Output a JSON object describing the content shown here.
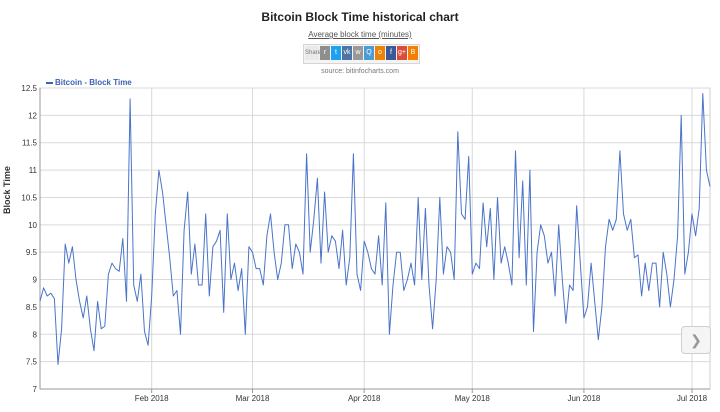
{
  "header": {
    "title": "Bitcoin Block Time historical chart",
    "subtitle": "Average block time (minutes)",
    "source": "source: bitinfocharts.com",
    "share": {
      "label": "Share",
      "buttons": [
        {
          "name": "reddit",
          "glyph": "r",
          "color": "#8e8e8e"
        },
        {
          "name": "twitter",
          "glyph": "t",
          "color": "#1da1f2"
        },
        {
          "name": "vk",
          "glyph": "vk",
          "color": "#4c75a3"
        },
        {
          "name": "weibo",
          "glyph": "w",
          "color": "#999999"
        },
        {
          "name": "qq",
          "glyph": "Q",
          "color": "#4c9bd5"
        },
        {
          "name": "odnoklassniki",
          "glyph": "o",
          "color": "#ee8208"
        },
        {
          "name": "facebook",
          "glyph": "f",
          "color": "#3b5998"
        },
        {
          "name": "google-plus",
          "glyph": "g+",
          "color": "#dd4b39"
        },
        {
          "name": "blogger",
          "glyph": "B",
          "color": "#f57d00"
        }
      ]
    }
  },
  "nav": {
    "glyph": "❯"
  },
  "chart_data": {
    "type": "line",
    "title": "Bitcoin Block Time historical chart",
    "subtitle": "Average block time (minutes)",
    "xlabel": "",
    "ylabel": "Block Time",
    "ylim": [
      7,
      12.5
    ],
    "yticks": [
      7,
      7.5,
      8,
      8.5,
      9,
      9.5,
      10,
      10.5,
      11,
      11.5,
      12,
      12.5
    ],
    "xlim": [
      "2018-01-01",
      "2018-07-06"
    ],
    "xticks": [
      {
        "date": "2018-02-01",
        "label": "Feb 2018"
      },
      {
        "date": "2018-03-01",
        "label": "Mar 2018"
      },
      {
        "date": "2018-04-01",
        "label": "Apr 2018"
      },
      {
        "date": "2018-05-01",
        "label": "May 2018"
      },
      {
        "date": "2018-06-01",
        "label": "Jun 2018"
      },
      {
        "date": "2018-07-01",
        "label": "Jul 2018"
      }
    ],
    "grid": true,
    "legend_position": "top-left",
    "series": [
      {
        "name": "Bitcoin - Block Time",
        "color": "#4a74c9",
        "points": [
          [
            "2018-01-01",
            8.6
          ],
          [
            "2018-01-02",
            8.85
          ],
          [
            "2018-01-03",
            8.7
          ],
          [
            "2018-01-04",
            8.75
          ],
          [
            "2018-01-05",
            8.65
          ],
          [
            "2018-01-06",
            7.45
          ],
          [
            "2018-01-07",
            8.1
          ],
          [
            "2018-01-08",
            9.65
          ],
          [
            "2018-01-09",
            9.3
          ],
          [
            "2018-01-10",
            9.6
          ],
          [
            "2018-01-11",
            9.0
          ],
          [
            "2018-01-12",
            8.6
          ],
          [
            "2018-01-13",
            8.3
          ],
          [
            "2018-01-14",
            8.7
          ],
          [
            "2018-01-15",
            8.1
          ],
          [
            "2018-01-16",
            7.7
          ],
          [
            "2018-01-17",
            8.6
          ],
          [
            "2018-01-18",
            8.1
          ],
          [
            "2018-01-19",
            8.15
          ],
          [
            "2018-01-20",
            9.1
          ],
          [
            "2018-01-21",
            9.3
          ],
          [
            "2018-01-22",
            9.2
          ],
          [
            "2018-01-23",
            9.15
          ],
          [
            "2018-01-24",
            9.75
          ],
          [
            "2018-01-25",
            8.6
          ],
          [
            "2018-01-26",
            12.3
          ],
          [
            "2018-01-27",
            8.9
          ],
          [
            "2018-01-28",
            8.6
          ],
          [
            "2018-01-29",
            9.1
          ],
          [
            "2018-01-30",
            8.05
          ],
          [
            "2018-01-31",
            7.8
          ],
          [
            "2018-02-01",
            8.7
          ],
          [
            "2018-02-02",
            10.2
          ],
          [
            "2018-02-03",
            11.0
          ],
          [
            "2018-02-04",
            10.6
          ],
          [
            "2018-02-05",
            10.0
          ],
          [
            "2018-02-06",
            9.4
          ],
          [
            "2018-02-07",
            8.7
          ],
          [
            "2018-02-08",
            8.8
          ],
          [
            "2018-02-09",
            8.0
          ],
          [
            "2018-02-10",
            9.9
          ],
          [
            "2018-02-11",
            10.6
          ],
          [
            "2018-02-12",
            9.1
          ],
          [
            "2018-02-13",
            9.65
          ],
          [
            "2018-02-14",
            8.9
          ],
          [
            "2018-02-15",
            8.9
          ],
          [
            "2018-02-16",
            10.2
          ],
          [
            "2018-02-17",
            8.7
          ],
          [
            "2018-02-18",
            9.6
          ],
          [
            "2018-02-19",
            9.7
          ],
          [
            "2018-02-20",
            9.9
          ],
          [
            "2018-02-21",
            8.4
          ],
          [
            "2018-02-22",
            10.2
          ],
          [
            "2018-02-23",
            9.0
          ],
          [
            "2018-02-24",
            9.3
          ],
          [
            "2018-02-25",
            8.8
          ],
          [
            "2018-02-26",
            9.2
          ],
          [
            "2018-02-27",
            8.0
          ],
          [
            "2018-02-28",
            9.6
          ],
          [
            "2018-03-01",
            9.5
          ],
          [
            "2018-03-02",
            9.2
          ],
          [
            "2018-03-03",
            9.2
          ],
          [
            "2018-03-04",
            8.9
          ],
          [
            "2018-03-05",
            9.8
          ],
          [
            "2018-03-06",
            10.2
          ],
          [
            "2018-03-07",
            9.5
          ],
          [
            "2018-03-08",
            9.0
          ],
          [
            "2018-03-09",
            9.3
          ],
          [
            "2018-03-10",
            10.0
          ],
          [
            "2018-03-11",
            10.0
          ],
          [
            "2018-03-12",
            9.2
          ],
          [
            "2018-03-13",
            9.65
          ],
          [
            "2018-03-14",
            9.5
          ],
          [
            "2018-03-15",
            9.1
          ],
          [
            "2018-03-16",
            11.3
          ],
          [
            "2018-03-17",
            9.5
          ],
          [
            "2018-03-18",
            10.1
          ],
          [
            "2018-03-19",
            10.85
          ],
          [
            "2018-03-20",
            9.3
          ],
          [
            "2018-03-21",
            10.6
          ],
          [
            "2018-03-22",
            9.5
          ],
          [
            "2018-03-23",
            9.8
          ],
          [
            "2018-03-24",
            9.7
          ],
          [
            "2018-03-25",
            9.2
          ],
          [
            "2018-03-26",
            9.9
          ],
          [
            "2018-03-27",
            8.9
          ],
          [
            "2018-03-28",
            9.4
          ],
          [
            "2018-03-29",
            11.3
          ],
          [
            "2018-03-30",
            9.1
          ],
          [
            "2018-03-31",
            8.8
          ],
          [
            "2018-04-01",
            9.7
          ],
          [
            "2018-04-02",
            9.5
          ],
          [
            "2018-04-03",
            9.2
          ],
          [
            "2018-04-04",
            9.1
          ],
          [
            "2018-04-05",
            9.8
          ],
          [
            "2018-04-06",
            8.9
          ],
          [
            "2018-04-07",
            10.4
          ],
          [
            "2018-04-08",
            8.0
          ],
          [
            "2018-04-09",
            8.9
          ],
          [
            "2018-04-10",
            9.5
          ],
          [
            "2018-04-11",
            9.5
          ],
          [
            "2018-04-12",
            8.8
          ],
          [
            "2018-04-13",
            9.0
          ],
          [
            "2018-04-14",
            9.3
          ],
          [
            "2018-04-15",
            8.9
          ],
          [
            "2018-04-16",
            10.5
          ],
          [
            "2018-04-17",
            9.0
          ],
          [
            "2018-04-18",
            10.3
          ],
          [
            "2018-04-19",
            8.9
          ],
          [
            "2018-04-20",
            8.1
          ],
          [
            "2018-04-21",
            9.0
          ],
          [
            "2018-04-22",
            10.5
          ],
          [
            "2018-04-23",
            9.1
          ],
          [
            "2018-04-24",
            9.6
          ],
          [
            "2018-04-25",
            9.5
          ],
          [
            "2018-04-26",
            9.0
          ],
          [
            "2018-04-27",
            11.7
          ],
          [
            "2018-04-28",
            10.2
          ],
          [
            "2018-04-29",
            10.1
          ],
          [
            "2018-04-30",
            11.25
          ],
          [
            "2018-05-01",
            9.1
          ],
          [
            "2018-05-02",
            9.3
          ],
          [
            "2018-05-03",
            9.2
          ],
          [
            "2018-05-04",
            10.4
          ],
          [
            "2018-05-05",
            9.6
          ],
          [
            "2018-05-06",
            10.3
          ],
          [
            "2018-05-07",
            9.0
          ],
          [
            "2018-05-08",
            10.5
          ],
          [
            "2018-05-09",
            9.3
          ],
          [
            "2018-05-10",
            9.6
          ],
          [
            "2018-05-11",
            9.3
          ],
          [
            "2018-05-12",
            8.9
          ],
          [
            "2018-05-13",
            11.35
          ],
          [
            "2018-05-14",
            9.4
          ],
          [
            "2018-05-15",
            10.8
          ],
          [
            "2018-05-16",
            8.9
          ],
          [
            "2018-05-17",
            11.0
          ],
          [
            "2018-05-18",
            8.05
          ],
          [
            "2018-05-19",
            9.5
          ],
          [
            "2018-05-20",
            10.0
          ],
          [
            "2018-05-21",
            9.8
          ],
          [
            "2018-05-22",
            9.3
          ],
          [
            "2018-05-23",
            9.5
          ],
          [
            "2018-05-24",
            8.7
          ],
          [
            "2018-05-25",
            10.0
          ],
          [
            "2018-05-26",
            9.0
          ],
          [
            "2018-05-27",
            8.2
          ],
          [
            "2018-05-28",
            8.9
          ],
          [
            "2018-05-29",
            8.8
          ],
          [
            "2018-05-30",
            10.35
          ],
          [
            "2018-05-31",
            9.3
          ],
          [
            "2018-06-01",
            8.3
          ],
          [
            "2018-06-02",
            8.5
          ],
          [
            "2018-06-03",
            9.3
          ],
          [
            "2018-06-04",
            8.6
          ],
          [
            "2018-06-05",
            7.9
          ],
          [
            "2018-06-06",
            8.5
          ],
          [
            "2018-06-07",
            9.6
          ],
          [
            "2018-06-08",
            10.1
          ],
          [
            "2018-06-09",
            9.9
          ],
          [
            "2018-06-10",
            10.1
          ],
          [
            "2018-06-11",
            11.35
          ],
          [
            "2018-06-12",
            10.2
          ],
          [
            "2018-06-13",
            9.9
          ],
          [
            "2018-06-14",
            10.1
          ],
          [
            "2018-06-15",
            9.4
          ],
          [
            "2018-06-16",
            9.45
          ],
          [
            "2018-06-17",
            8.7
          ],
          [
            "2018-06-18",
            9.3
          ],
          [
            "2018-06-19",
            8.8
          ],
          [
            "2018-06-20",
            9.3
          ],
          [
            "2018-06-21",
            9.3
          ],
          [
            "2018-06-22",
            8.5
          ],
          [
            "2018-06-23",
            9.5
          ],
          [
            "2018-06-24",
            9.1
          ],
          [
            "2018-06-25",
            8.5
          ],
          [
            "2018-06-26",
            9.0
          ],
          [
            "2018-06-27",
            9.8
          ],
          [
            "2018-06-28",
            12.0
          ],
          [
            "2018-06-29",
            9.1
          ],
          [
            "2018-06-30",
            9.5
          ],
          [
            "2018-07-01",
            10.2
          ],
          [
            "2018-07-02",
            9.8
          ],
          [
            "2018-07-03",
            10.3
          ],
          [
            "2018-07-04",
            12.4
          ],
          [
            "2018-07-05",
            11.0
          ],
          [
            "2018-07-06",
            10.7
          ]
        ]
      }
    ]
  }
}
